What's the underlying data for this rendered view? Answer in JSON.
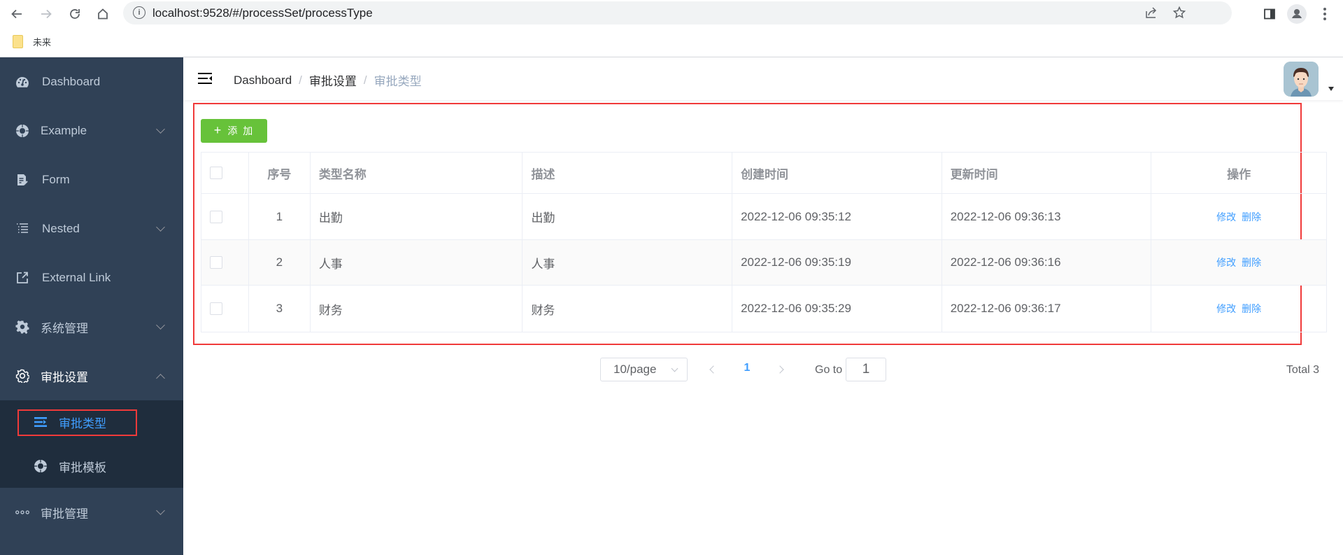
{
  "browser": {
    "url_host": "localhost",
    "url_path": ":9528/#/processSet/processType",
    "bookmarks": [
      {
        "label": "未来",
        "icon": "folder-icon"
      }
    ]
  },
  "sidebar": {
    "items": [
      {
        "label": "Dashboard",
        "icon": "dashboard-icon",
        "has_arrow": false
      },
      {
        "label": "Example",
        "icon": "example-icon",
        "has_arrow": true
      },
      {
        "label": "Form",
        "icon": "form-icon",
        "has_arrow": false
      },
      {
        "label": "Nested",
        "icon": "nested-icon",
        "has_arrow": true
      },
      {
        "label": "External Link",
        "icon": "external-link-icon",
        "has_arrow": false
      },
      {
        "label": "系统管理",
        "icon": "gear-icon",
        "has_arrow": true
      },
      {
        "label": "审批设置",
        "icon": "settings-icon",
        "has_arrow": true,
        "expanded": true
      },
      {
        "label": "审批管理",
        "icon": "more-icon",
        "has_arrow": true
      }
    ],
    "submenu": [
      {
        "label": "审批类型",
        "icon": "list-icon",
        "active": true
      },
      {
        "label": "审批模板",
        "icon": "template-icon",
        "active": false
      }
    ]
  },
  "navbar": {
    "breadcrumb": [
      "Dashboard",
      "审批设置",
      "审批类型"
    ],
    "breadcrumb_separator": "/"
  },
  "toolbar": {
    "add_label": "添 加",
    "add_icon": "+"
  },
  "table": {
    "columns": [
      "",
      "序号",
      "类型名称",
      "描述",
      "创建时间",
      "更新时间",
      "操作"
    ],
    "rows": [
      {
        "index": "1",
        "name": "出勤",
        "description": "出勤",
        "created": "2022-12-06 09:35:12",
        "updated": "2022-12-06 09:36:13"
      },
      {
        "index": "2",
        "name": "人事",
        "description": "人事",
        "created": "2022-12-06 09:35:19",
        "updated": "2022-12-06 09:36:16"
      },
      {
        "index": "3",
        "name": "财务",
        "description": "财务",
        "created": "2022-12-06 09:35:29",
        "updated": "2022-12-06 09:36:17"
      }
    ],
    "actions": {
      "edit": "修改",
      "delete": "删除"
    }
  },
  "pagination": {
    "page_size": "10/page",
    "current_page": "1",
    "goto_label": "Go to",
    "goto_value": "1",
    "total": "Total 3"
  },
  "colors": {
    "sidebar_bg": "#304156",
    "submenu_bg": "#1f2d3d",
    "active": "#409eff",
    "add_button": "#67c23a",
    "highlight": "#f03a3a"
  }
}
